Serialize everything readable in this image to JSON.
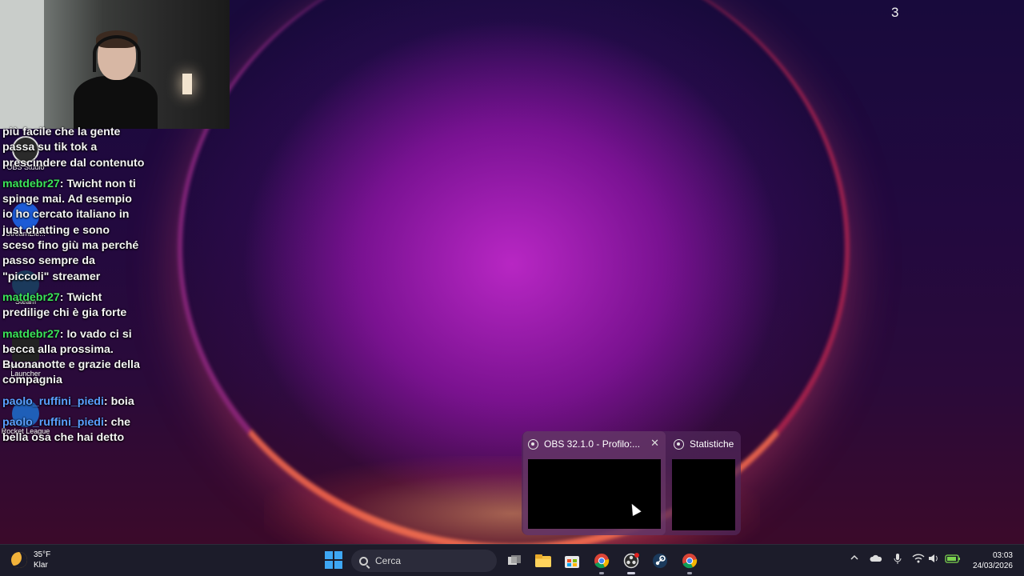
{
  "overlay": {
    "corner_number": "3"
  },
  "desktop_icons": [
    {
      "label": "OBS Studio"
    },
    {
      "label": "StreamEle..."
    },
    {
      "label": "Steam"
    },
    {
      "label": "Epic Games Launcher"
    },
    {
      "label": "Rocket League"
    }
  ],
  "chat": {
    "messages": [
      {
        "user": "",
        "text": "più facile che la gente passa su tik tok a prescindere dal contenuto"
      },
      {
        "user": "matdebr27",
        "color": "#3be35a",
        "text": "Twicht non ti spinge mai. Ad esempio io ho cercato italiano in just chatting e sono sceso fino giù ma perché passo sempre da \"piccoli\" streamer"
      },
      {
        "user": "matdebr27",
        "color": "#3be35a",
        "text": "Twicht predilige chi è gia forte"
      },
      {
        "user": "matdebr27",
        "color": "#3be35a",
        "text": "Io vado ci si becca alla prossima. Buonanotte e grazie della compagnia"
      },
      {
        "user": "paolo_ruffini_piedi",
        "color": "#5aa0ff",
        "text": "boia"
      },
      {
        "user": "paolo_ruffini_piedi",
        "color": "#5aa0ff",
        "text": "che bella osa che hai detto"
      }
    ]
  },
  "thumbnails": {
    "obs_title": "OBS 32.1.0 - Profilo:...",
    "stats_title": "Statistiche",
    "close_glyph": "✕"
  },
  "taskbar": {
    "weather_temp": "35°F",
    "weather_desc": "Klar",
    "search_placeholder": "Cerca",
    "time": "03:03",
    "date": "24/03/2026",
    "apps": [
      "task-view",
      "file-explorer",
      "microsoft-store",
      "chrome",
      "obs-studio",
      "steam",
      "chrome"
    ]
  }
}
